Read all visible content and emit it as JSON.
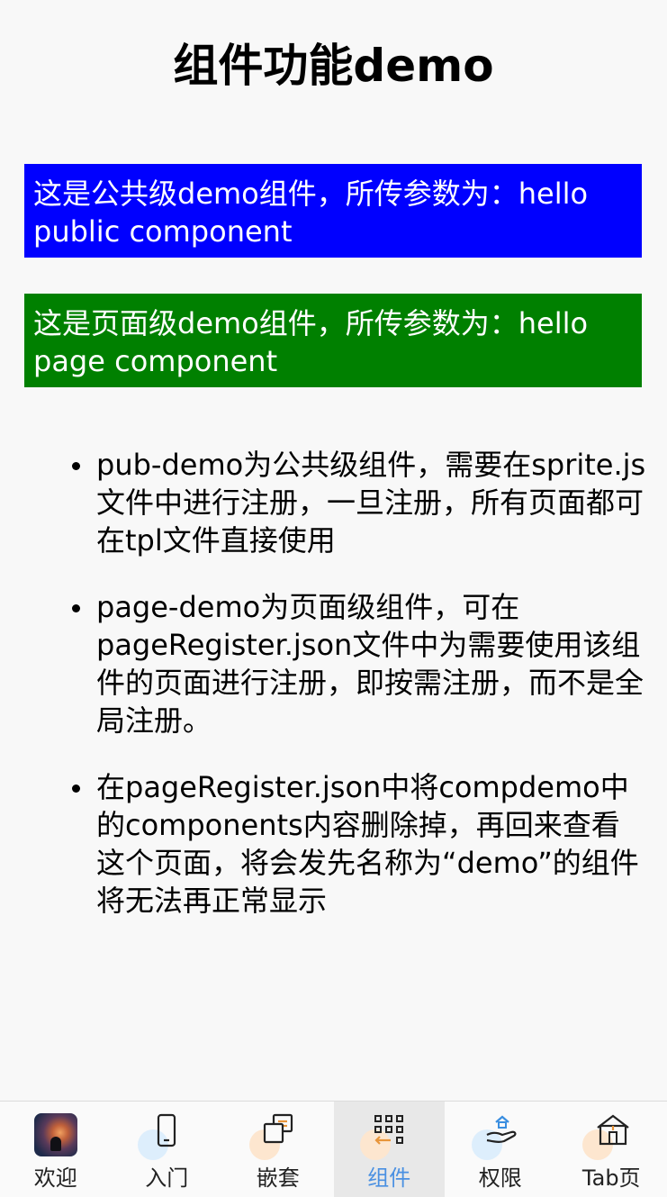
{
  "page": {
    "title": "组件功能demo"
  },
  "components": {
    "public_banner": "这是公共级demo组件，所传参数为：hello public component",
    "page_banner": "这是页面级demo组件，所传参数为：hello page component"
  },
  "notes": [
    "pub-demo为公共级组件，需要在sprite.js文件中进行注册，一旦注册，所有页面都可在tpl文件直接使用",
    "page-demo为页面级组件，可在pageRegister.json文件中为需要使用该组件的页面进行注册，即按需注册，而不是全局注册。",
    "在pageRegister.json中将compdemo中的components内容删除掉，再回来查看这个页面，将会发先名称为“demo”的组件将无法再正常显示"
  ],
  "tabbar": {
    "active_index": 3,
    "tabs": [
      {
        "label": "欢迎",
        "icon": "avatar-icon"
      },
      {
        "label": "入门",
        "icon": "phone-icon"
      },
      {
        "label": "嵌套",
        "icon": "windows-icon"
      },
      {
        "label": "组件",
        "icon": "grid-icon"
      },
      {
        "label": "权限",
        "icon": "hand-home-icon"
      },
      {
        "label": "Tab页",
        "icon": "house-icon"
      }
    ]
  },
  "colors": {
    "public_banner_bg": "#0000ff",
    "page_banner_bg": "#008000",
    "active_tab_text": "#4a90e2",
    "active_tab_bg": "#e8e8e8"
  }
}
